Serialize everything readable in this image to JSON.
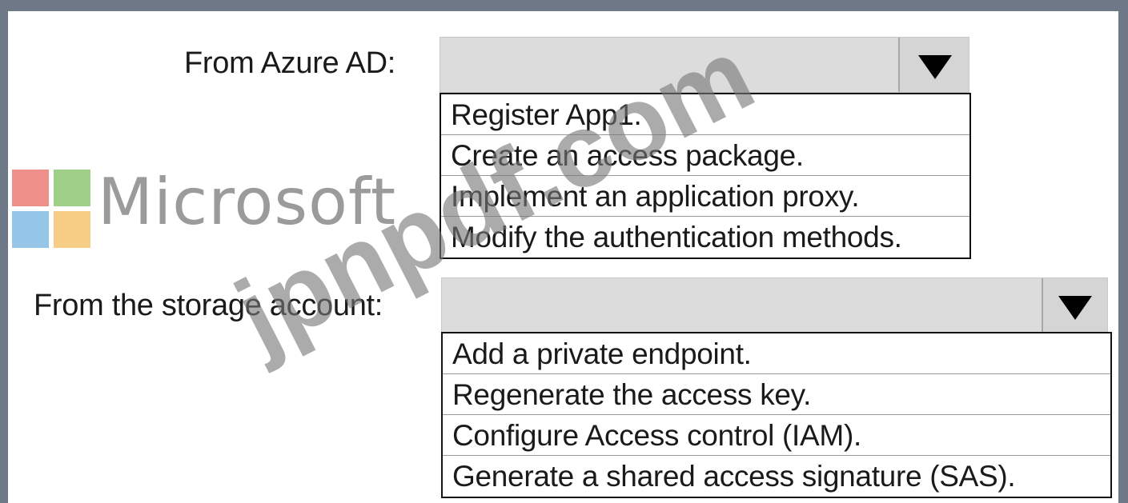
{
  "logo": {
    "text": "Microsoft",
    "colors": [
      "#f25022",
      "#7fba00",
      "#00a4ef",
      "#ffb900"
    ]
  },
  "watermark": {
    "text": "jpnpdf.com"
  },
  "questions": [
    {
      "label": "From Azure AD:",
      "selected_value": "",
      "options": [
        "Register App1.",
        "Create an access package.",
        "Implement an application proxy.",
        "Modify the authentication methods."
      ]
    },
    {
      "label": "From the storage account:",
      "selected_value": "",
      "options": [
        "Add a private endpoint.",
        "Regenerate the access key.",
        "Configure Access control (IAM).",
        "Generate a shared access signature (SAS)."
      ]
    }
  ]
}
